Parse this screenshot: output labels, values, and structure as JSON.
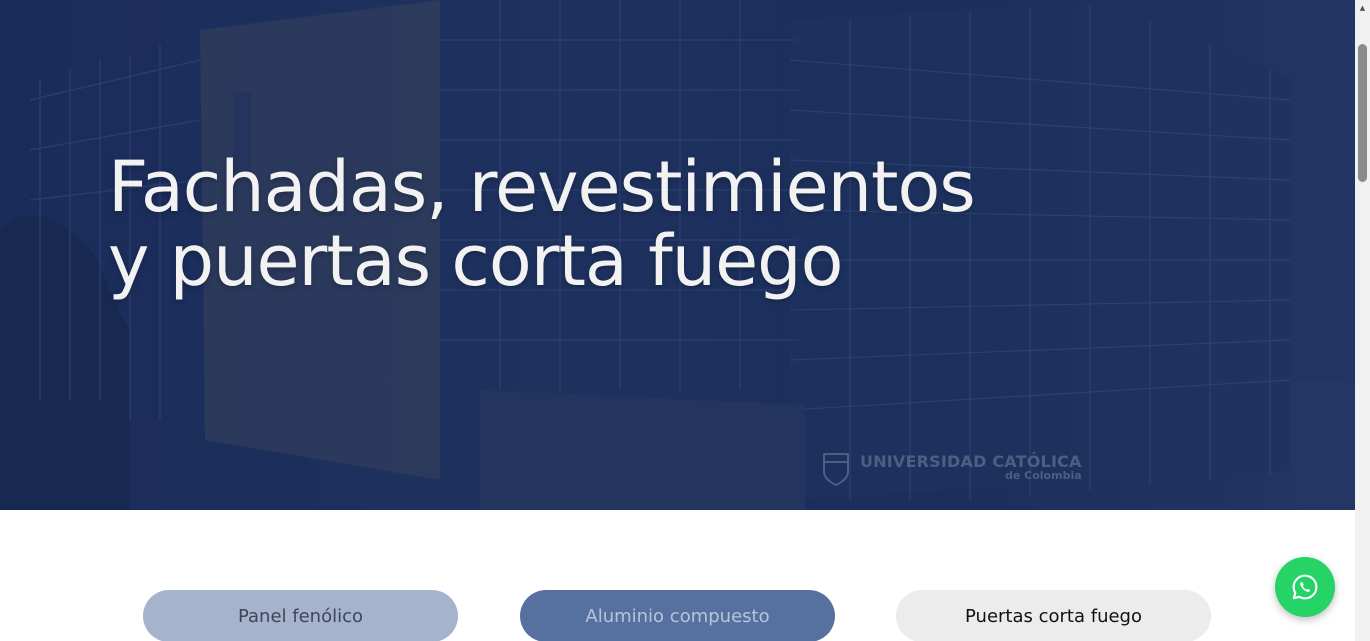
{
  "hero": {
    "title_line1": "Fachadas, revestimientos",
    "title_line2": "y puertas corta fuego",
    "sign_main": "UNIVERSIDAD CATÓLICA",
    "sign_sub": "de Colombia"
  },
  "tabs": [
    {
      "label": "Panel fenólico"
    },
    {
      "label": "Aluminio compuesto"
    },
    {
      "label": "Puertas corta fuego"
    }
  ],
  "whatsapp": {
    "icon": "whatsapp-icon",
    "color": "#25d366"
  },
  "colors": {
    "hero_overlay": "#1d2f5e",
    "tab_1": "#a5b3cc",
    "tab_2": "#5671a0",
    "tab_3": "#ececec"
  }
}
